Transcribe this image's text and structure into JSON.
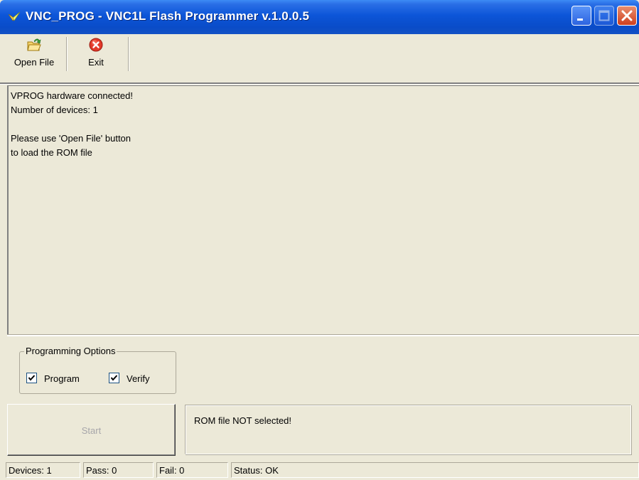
{
  "window": {
    "title": "VNC_PROG - VNC1L Flash Programmer v.1.0.0.5"
  },
  "toolbar": {
    "open_label": "Open File",
    "exit_label": "Exit",
    "open_icon": "open-folder-icon",
    "exit_icon": "exit-icon"
  },
  "log": {
    "text": "VPROG hardware connected!\nNumber of devices: 1\n\nPlease use 'Open File' button\nto load the ROM file"
  },
  "options": {
    "legend": "Programming Options",
    "program_label": "Program",
    "program_checked": true,
    "verify_label": "Verify",
    "verify_checked": true
  },
  "start_label": "Start",
  "message": "ROM file NOT selected!",
  "statusbar": {
    "devices": "Devices: 1",
    "pass": "Pass: 0",
    "fail": "Fail: 0",
    "status": "Status: OK"
  },
  "colors": {
    "titlebar": "#0a4cc8",
    "face": "#ece9d8",
    "close": "#cf3f1f"
  }
}
